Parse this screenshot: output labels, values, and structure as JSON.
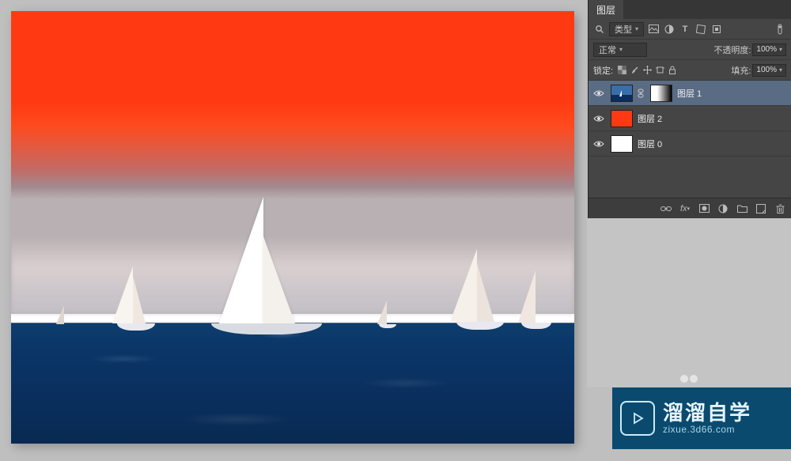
{
  "panel": {
    "tab": "图层",
    "filter_label": "类型",
    "blend_mode": "正常",
    "opacity_label": "不透明度:",
    "opacity_value": "100%",
    "lock_label": "锁定:",
    "fill_label": "填充:",
    "fill_value": "100%",
    "filter_icons": [
      "image-icon",
      "adjustment-icon",
      "type-icon",
      "shape-icon",
      "smartobj-icon"
    ]
  },
  "layers": [
    {
      "name": "图层 1",
      "visible": true,
      "has_mask": true,
      "swatch": "img",
      "selected": true
    },
    {
      "name": "图层 2",
      "visible": true,
      "has_mask": false,
      "swatch": "red",
      "selected": false
    },
    {
      "name": "图层 0",
      "visible": true,
      "has_mask": false,
      "swatch": "white",
      "selected": false
    }
  ],
  "footer_icons": [
    "link-icon",
    "fx-icon",
    "mask-icon",
    "adjustment-circle-icon",
    "folder-icon",
    "new-layer-icon",
    "trash-icon"
  ],
  "watermark": {
    "title": "溜溜自学",
    "url": "zixue.3d66.com"
  }
}
